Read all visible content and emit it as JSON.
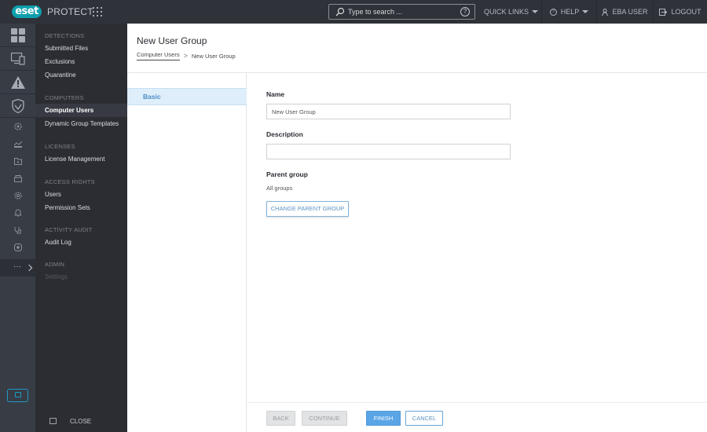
{
  "topbar": {
    "logo": "eset",
    "product": "PROTECT",
    "search_placeholder": "Type to search ...",
    "search_help": "?",
    "quick_links": "QUICK LINKS",
    "help": "HELP",
    "user": "EBA USER",
    "logout": "LOGOUT"
  },
  "rail": {
    "icons": [
      "dashboard-icon",
      "computers-icon",
      "detections-icon",
      "protections-icon",
      "settings-gear-icon",
      "reports-icon",
      "tasks-icon",
      "installers-icon",
      "policies-icon",
      "notifications-icon",
      "status-overview-icon",
      "more-icon"
    ],
    "more_label": "···"
  },
  "menu": {
    "sections": [
      {
        "heading": "DETECTIONS",
        "items": [
          "Submitted Files",
          "Exclusions",
          "Quarantine"
        ]
      },
      {
        "heading": "COMPUTERS",
        "items": [
          "Computer Users",
          "Dynamic Group Templates"
        ]
      },
      {
        "heading": "LICENSES",
        "items": [
          "License Management"
        ]
      },
      {
        "heading": "ACCESS RIGHTS",
        "items": [
          "Users",
          "Permission Sets"
        ]
      },
      {
        "heading": "ACTIVITY AUDIT",
        "items": [
          "Audit Log"
        ]
      },
      {
        "heading": "ADMIN",
        "items": [
          "Settings"
        ]
      }
    ],
    "active_item": "Computer Users",
    "close_label": "CLOSE"
  },
  "page": {
    "title": "New User Group",
    "breadcrumb": [
      "Computer Users",
      "New User Group"
    ]
  },
  "wizard": {
    "steps": [
      "Basic"
    ],
    "active_step": "Basic"
  },
  "form": {
    "name_label": "Name",
    "name_value": "New User Group",
    "description_label": "Description",
    "description_value": "",
    "parent_label": "Parent group",
    "parent_value": "All groups",
    "change_parent_label": "CHANGE PARENT GROUP"
  },
  "footer": {
    "back": "BACK",
    "continue": "CONTINUE",
    "finish": "FINISH",
    "cancel": "CANCEL"
  },
  "colors": {
    "topbar_bg": "#2f3239",
    "brand_teal": "#0f9fae",
    "accent_blue": "#5aa5e6",
    "menu_bg": "#2b2d33",
    "rail_bg": "#383c45"
  }
}
